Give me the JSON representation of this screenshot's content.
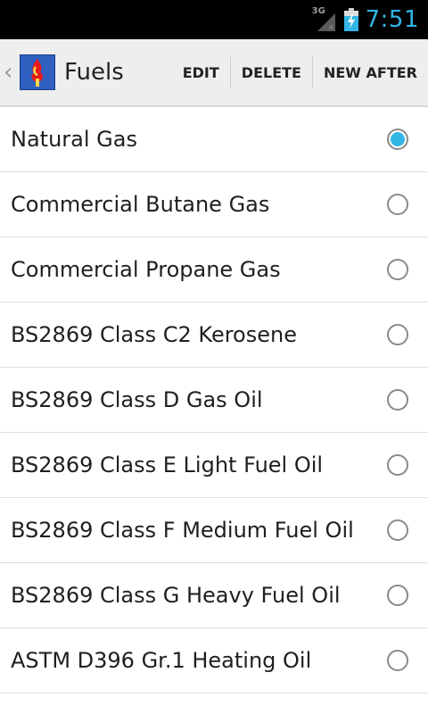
{
  "status_bar": {
    "network": "3G",
    "time": "7:51",
    "accent": "#33b5e5"
  },
  "action_bar": {
    "up_icon": "chevron-left-icon",
    "app_icon": "fuel-icon",
    "title": "Fuels",
    "actions": [
      {
        "label": "EDIT"
      },
      {
        "label": "DELETE"
      },
      {
        "label": "NEW AFTER"
      }
    ]
  },
  "fuels": [
    {
      "label": "Natural Gas",
      "selected": true
    },
    {
      "label": "Commercial Butane Gas",
      "selected": false
    },
    {
      "label": "Commercial Propane Gas",
      "selected": false
    },
    {
      "label": "BS2869 Class C2 Kerosene",
      "selected": false
    },
    {
      "label": "BS2869 Class D Gas Oil",
      "selected": false
    },
    {
      "label": "BS2869 Class E Light Fuel Oil",
      "selected": false
    },
    {
      "label": "BS2869 Class F Medium Fuel Oil",
      "selected": false
    },
    {
      "label": "BS2869 Class G Heavy Fuel Oil",
      "selected": false
    },
    {
      "label": "ASTM D396 Gr.1 Heating Oil",
      "selected": false
    }
  ]
}
